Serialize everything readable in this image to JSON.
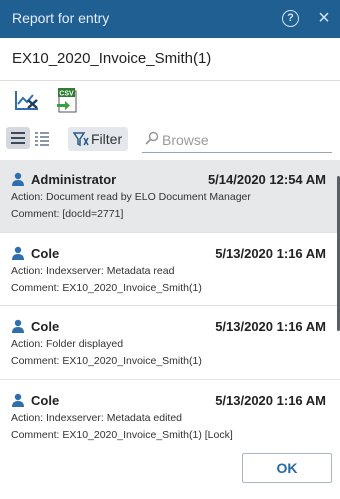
{
  "dialog": {
    "title": "Report for entry",
    "help_symbol": "?",
    "close_symbol": "×",
    "document_name": "EX10_2020_Invoice_Smith(1)"
  },
  "toolbar": {
    "tools": [
      {
        "icon": "remove-filter-chart-icon"
      },
      {
        "icon": "csv-export-icon",
        "text": "CSV"
      }
    ],
    "filter_label": "Filter",
    "search_placeholder": "Browse"
  },
  "entries": [
    {
      "user": "Administrator",
      "date": "5/14/2020 12:54 AM",
      "action": "Action: Document read by ELO Document Manager",
      "comment": "Comment: [docId=2771]",
      "selected": true
    },
    {
      "user": "Cole",
      "date": "5/13/2020 1:16 AM",
      "action": "Action: Indexserver: Metadata read",
      "comment": "Comment: EX10_2020_Invoice_Smith(1)"
    },
    {
      "user": "Cole",
      "date": "5/13/2020 1:16 AM",
      "action": "Action: Folder displayed",
      "comment": "Comment: EX10_2020_Invoice_Smith(1)"
    },
    {
      "user": "Cole",
      "date": "5/13/2020 1:16 AM",
      "action": "Action: Indexserver: Metadata edited",
      "comment": "Comment: EX10_2020_Invoice_Smith(1) [Lock]"
    }
  ],
  "footer": {
    "ok_label": "OK"
  },
  "colors": {
    "titlebar": "#1f5f92",
    "accent": "#2a6aa0",
    "user_icon": "#2f6fae"
  }
}
